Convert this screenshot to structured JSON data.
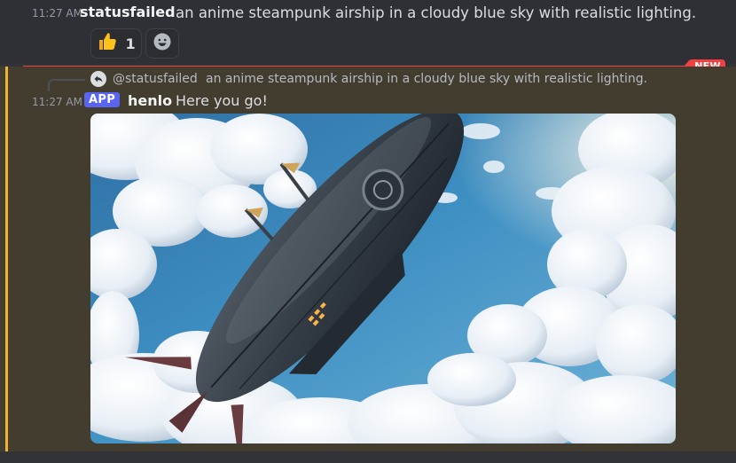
{
  "message_1": {
    "timestamp": "11:27 AM",
    "username": "statusfailed",
    "content": "an anime steampunk airship in a cloudy blue sky with realistic lighting.",
    "reactions": [
      {
        "emoji": "👍",
        "count": "1"
      },
      {
        "icon": "add-reaction-smiley-icon"
      }
    ]
  },
  "divider": {
    "label": "NEW",
    "color": "#f23f42"
  },
  "message_2": {
    "reply": {
      "mention": "@statusfailed",
      "text": "an anime steampunk airship in a cloudy blue sky with realistic lighting."
    },
    "timestamp": "11:27 AM",
    "app_tag": "APP",
    "username": "henlo",
    "content": "Here you go!",
    "attachment": {
      "type": "image",
      "subject": "steampunk airship in cloudy blue sky"
    },
    "highlight_color": "#f0b232"
  }
}
